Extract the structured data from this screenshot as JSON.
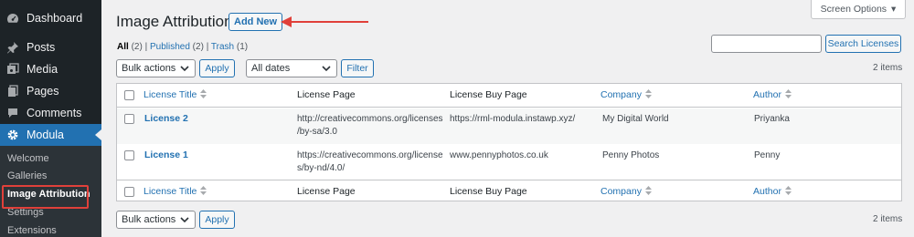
{
  "sidebar": {
    "items": [
      {
        "label": "Dashboard",
        "icon": "dashboard-icon"
      },
      {
        "label": "Posts",
        "icon": "pin-icon"
      },
      {
        "label": "Media",
        "icon": "media-icon"
      },
      {
        "label": "Pages",
        "icon": "pages-icon"
      },
      {
        "label": "Comments",
        "icon": "comment-icon"
      },
      {
        "label": "Modula",
        "icon": "gear-icon"
      }
    ],
    "submenu": [
      "Welcome",
      "Galleries",
      "Image Attribution",
      "Settings",
      "Extensions"
    ]
  },
  "header": {
    "title": "Image Attribution",
    "add_new": "Add New",
    "screen_options": "Screen Options"
  },
  "filters": {
    "all_label": "All",
    "all_count": "(2)",
    "published_label": "Published",
    "published_count": "(2)",
    "trash_label": "Trash",
    "trash_count": "(1)",
    "separator": "|"
  },
  "search": {
    "button": "Search Licenses",
    "value": ""
  },
  "toolbar_top": {
    "bulk_actions": "Bulk actions",
    "apply": "Apply",
    "dates": "All dates",
    "filter": "Filter",
    "items": "2 items"
  },
  "toolbar_bottom": {
    "bulk_actions": "Bulk actions",
    "apply": "Apply",
    "items": "2 items"
  },
  "table": {
    "columns": [
      "License Title",
      "License Page",
      "License Buy Page",
      "Company",
      "Author"
    ],
    "rows": [
      {
        "title": "License 2",
        "page_line1": "http://creativecommons.org/licenses",
        "page_line2": "/by-sa/3.0",
        "buy_page": "https://rml-modula.instawp.xyz/",
        "company": "My Digital World",
        "author": "Priyanka"
      },
      {
        "title": "License 1",
        "page_line1": "https://creativecommons.org/license",
        "page_line2": "s/by-nd/4.0/",
        "buy_page": "www.pennyphotos.co.uk",
        "company": "Penny Photos",
        "author": "Penny"
      }
    ]
  },
  "colors": {
    "sidebar_bg": "#1d2327",
    "accent": "#2271b1",
    "annotation": "#e0403a"
  }
}
